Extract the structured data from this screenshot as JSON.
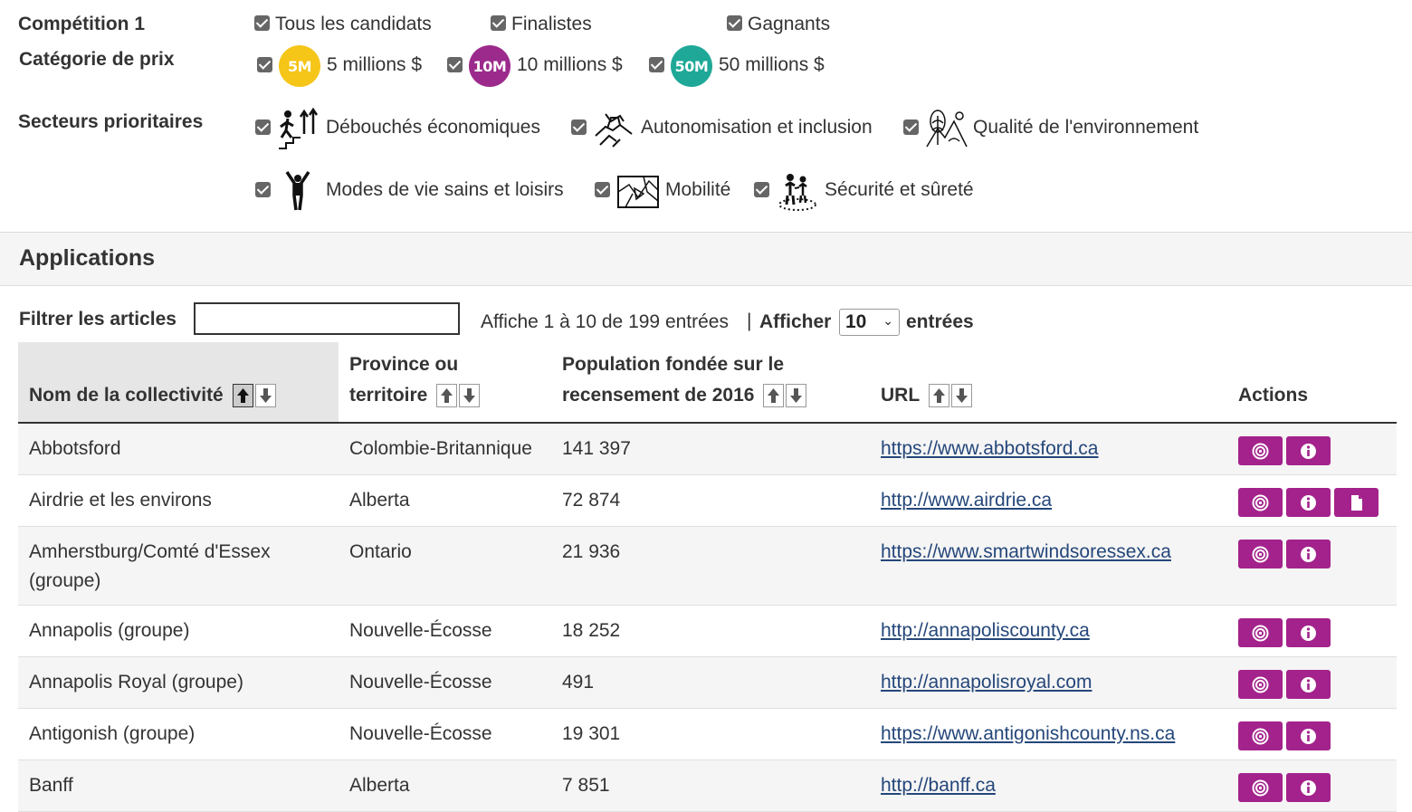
{
  "filters": {
    "competition_label": "Compétition 1",
    "competition_options": [
      {
        "label": "Tous les candidats",
        "checked": true
      },
      {
        "label": "Finalistes",
        "checked": true
      },
      {
        "label": "Gagnants",
        "checked": true
      }
    ],
    "prize_label": "Catégorie de prix",
    "prize_options": [
      {
        "badge": "5M",
        "label": "5 millions $",
        "color": "#f5c518",
        "checked": true
      },
      {
        "badge": "10M",
        "label": "10 millions $",
        "color": "#9c2a8c",
        "checked": true
      },
      {
        "badge": "50M",
        "label": "50 millions $",
        "color": "#1fa898",
        "checked": true
      }
    ],
    "sectors_label": "Secteurs prioritaires",
    "sectors": [
      {
        "label": "Débouchés économiques",
        "icon": "economic-icon",
        "checked": true
      },
      {
        "label": "Autonomisation et inclusion",
        "icon": "handshake-icon",
        "checked": true
      },
      {
        "label": "Qualité de l'environnement",
        "icon": "environment-icon",
        "checked": true
      },
      {
        "label": "Modes de vie sains et loisirs",
        "icon": "person-icon",
        "checked": true
      },
      {
        "label": "Mobilité",
        "icon": "map-icon",
        "checked": true
      },
      {
        "label": "Sécurité et sûreté",
        "icon": "family-icon",
        "checked": true
      }
    ]
  },
  "applications": {
    "title": "Applications",
    "filter_label": "Filtrer les articles",
    "filter_value": "",
    "info_text": "Affiche 1 à 10 de 199 entrées",
    "separator": "|",
    "show_label": "Afficher",
    "page_size": "10",
    "entries_label": "entrées",
    "columns": [
      "Nom de la collectivité",
      "Province ou territoire",
      "Population fondée sur le recensement de 2016",
      "URL",
      "Actions"
    ],
    "rows": [
      {
        "name": "Abbotsford",
        "province": "Colombie-Britannique",
        "population": "141 397",
        "url": "https://www.abbotsford.ca",
        "actions": [
          "target-icon",
          "info-icon"
        ]
      },
      {
        "name": "Airdrie et les environs",
        "province": "Alberta",
        "population": "72 874",
        "url": "http://www.airdrie.ca",
        "actions": [
          "target-icon",
          "info-icon",
          "document-icon"
        ]
      },
      {
        "name": "Amherstburg/Comté d'Essex (groupe)",
        "province": "Ontario",
        "population": "21 936",
        "url": "https://www.smartwindsoressex.ca",
        "actions": [
          "target-icon",
          "info-icon"
        ]
      },
      {
        "name": "Annapolis (groupe)",
        "province": "Nouvelle-Écosse",
        "population": "18 252",
        "url": "http://annapoliscounty.ca",
        "actions": [
          "target-icon",
          "info-icon"
        ]
      },
      {
        "name": "Annapolis Royal (groupe)",
        "province": "Nouvelle-Écosse",
        "population": "491",
        "url": "http://annapolisroyal.com",
        "actions": [
          "target-icon",
          "info-icon"
        ]
      },
      {
        "name": "Antigonish (groupe)",
        "province": "Nouvelle-Écosse",
        "population": "19 301",
        "url": "https://www.antigonishcounty.ns.ca",
        "actions": [
          "target-icon",
          "info-icon"
        ]
      },
      {
        "name": "Banff",
        "province": "Alberta",
        "population": "7 851",
        "url": "http://banff.ca",
        "actions": [
          "target-icon",
          "info-icon"
        ]
      }
    ],
    "accent_color": "#a3228c"
  }
}
